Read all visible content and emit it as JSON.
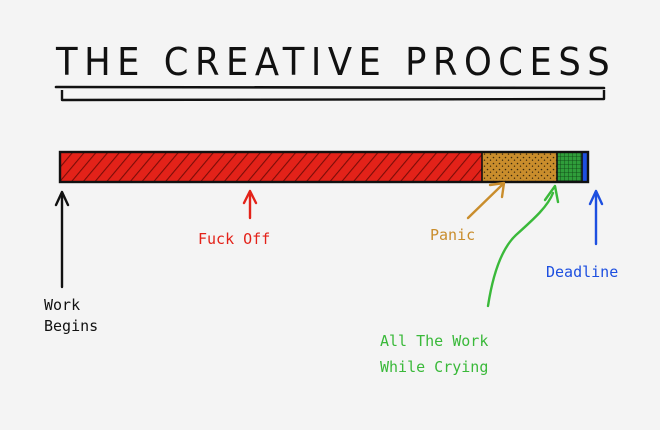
{
  "title": "THE CREATIVE PROCESS",
  "timeline": [
    {
      "key": "fuck_off",
      "label": "Fuck Off",
      "color": "#e32219",
      "pattern": "hatch"
    },
    {
      "key": "panic",
      "label": "Panic",
      "color": "#c98d2c",
      "pattern": "dots"
    },
    {
      "key": "work_crying",
      "label": "All The Work While Crying",
      "color": "#2f9d3a",
      "pattern": "grid"
    }
  ],
  "labels": {
    "start_line1": "Work",
    "start_line2": "Begins",
    "fuck_off": "Fuck Off",
    "panic": "Panic",
    "deadline": "Deadline",
    "work_line1": "All The Work",
    "work_line2": "While Crying"
  },
  "colors": {
    "ink": "#111111",
    "red": "#e32219",
    "panic": "#c98d2c",
    "green": "#3ab93a",
    "blue": "#1d4fe0",
    "background": "#f4f4f4"
  }
}
